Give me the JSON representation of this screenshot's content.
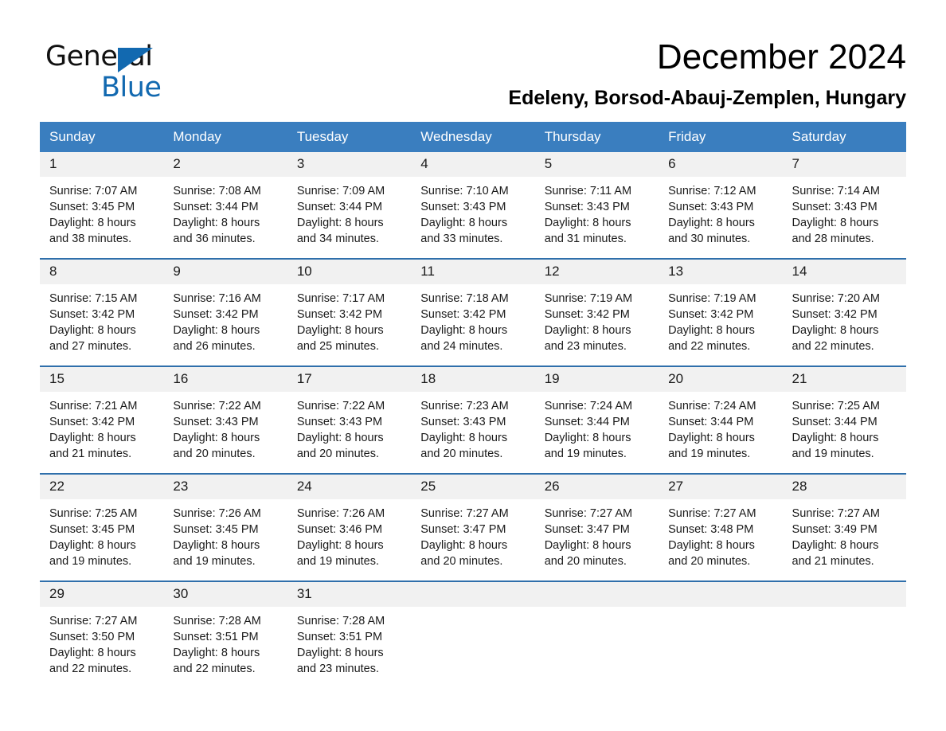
{
  "brand": {
    "name_part1": "General",
    "name_part2": "Blue",
    "logo_icon": "triangle-flag-icon",
    "accent_color": "#1269b0"
  },
  "header": {
    "month_title": "December 2024",
    "location": "Edeleny, Borsod-Abauj-Zemplen, Hungary"
  },
  "theme": {
    "header_blue": "#3a7ebf",
    "row_divider_blue": "#2f6fab",
    "day_band_gray": "#f1f1f1"
  },
  "calendar": {
    "weekdays": [
      "Sunday",
      "Monday",
      "Tuesday",
      "Wednesday",
      "Thursday",
      "Friday",
      "Saturday"
    ],
    "labels": {
      "sunrise": "Sunrise:",
      "sunset": "Sunset:",
      "daylight": "Daylight:"
    },
    "weeks": [
      [
        {
          "date": "1",
          "sunrise": "Sunrise: 7:07 AM",
          "sunset": "Sunset: 3:45 PM",
          "daylight_line1": "Daylight: 8 hours",
          "daylight_line2": "and 38 minutes."
        },
        {
          "date": "2",
          "sunrise": "Sunrise: 7:08 AM",
          "sunset": "Sunset: 3:44 PM",
          "daylight_line1": "Daylight: 8 hours",
          "daylight_line2": "and 36 minutes."
        },
        {
          "date": "3",
          "sunrise": "Sunrise: 7:09 AM",
          "sunset": "Sunset: 3:44 PM",
          "daylight_line1": "Daylight: 8 hours",
          "daylight_line2": "and 34 minutes."
        },
        {
          "date": "4",
          "sunrise": "Sunrise: 7:10 AM",
          "sunset": "Sunset: 3:43 PM",
          "daylight_line1": "Daylight: 8 hours",
          "daylight_line2": "and 33 minutes."
        },
        {
          "date": "5",
          "sunrise": "Sunrise: 7:11 AM",
          "sunset": "Sunset: 3:43 PM",
          "daylight_line1": "Daylight: 8 hours",
          "daylight_line2": "and 31 minutes."
        },
        {
          "date": "6",
          "sunrise": "Sunrise: 7:12 AM",
          "sunset": "Sunset: 3:43 PM",
          "daylight_line1": "Daylight: 8 hours",
          "daylight_line2": "and 30 minutes."
        },
        {
          "date": "7",
          "sunrise": "Sunrise: 7:14 AM",
          "sunset": "Sunset: 3:43 PM",
          "daylight_line1": "Daylight: 8 hours",
          "daylight_line2": "and 28 minutes."
        }
      ],
      [
        {
          "date": "8",
          "sunrise": "Sunrise: 7:15 AM",
          "sunset": "Sunset: 3:42 PM",
          "daylight_line1": "Daylight: 8 hours",
          "daylight_line2": "and 27 minutes."
        },
        {
          "date": "9",
          "sunrise": "Sunrise: 7:16 AM",
          "sunset": "Sunset: 3:42 PM",
          "daylight_line1": "Daylight: 8 hours",
          "daylight_line2": "and 26 minutes."
        },
        {
          "date": "10",
          "sunrise": "Sunrise: 7:17 AM",
          "sunset": "Sunset: 3:42 PM",
          "daylight_line1": "Daylight: 8 hours",
          "daylight_line2": "and 25 minutes."
        },
        {
          "date": "11",
          "sunrise": "Sunrise: 7:18 AM",
          "sunset": "Sunset: 3:42 PM",
          "daylight_line1": "Daylight: 8 hours",
          "daylight_line2": "and 24 minutes."
        },
        {
          "date": "12",
          "sunrise": "Sunrise: 7:19 AM",
          "sunset": "Sunset: 3:42 PM",
          "daylight_line1": "Daylight: 8 hours",
          "daylight_line2": "and 23 minutes."
        },
        {
          "date": "13",
          "sunrise": "Sunrise: 7:19 AM",
          "sunset": "Sunset: 3:42 PM",
          "daylight_line1": "Daylight: 8 hours",
          "daylight_line2": "and 22 minutes."
        },
        {
          "date": "14",
          "sunrise": "Sunrise: 7:20 AM",
          "sunset": "Sunset: 3:42 PM",
          "daylight_line1": "Daylight: 8 hours",
          "daylight_line2": "and 22 minutes."
        }
      ],
      [
        {
          "date": "15",
          "sunrise": "Sunrise: 7:21 AM",
          "sunset": "Sunset: 3:42 PM",
          "daylight_line1": "Daylight: 8 hours",
          "daylight_line2": "and 21 minutes."
        },
        {
          "date": "16",
          "sunrise": "Sunrise: 7:22 AM",
          "sunset": "Sunset: 3:43 PM",
          "daylight_line1": "Daylight: 8 hours",
          "daylight_line2": "and 20 minutes."
        },
        {
          "date": "17",
          "sunrise": "Sunrise: 7:22 AM",
          "sunset": "Sunset: 3:43 PM",
          "daylight_line1": "Daylight: 8 hours",
          "daylight_line2": "and 20 minutes."
        },
        {
          "date": "18",
          "sunrise": "Sunrise: 7:23 AM",
          "sunset": "Sunset: 3:43 PM",
          "daylight_line1": "Daylight: 8 hours",
          "daylight_line2": "and 20 minutes."
        },
        {
          "date": "19",
          "sunrise": "Sunrise: 7:24 AM",
          "sunset": "Sunset: 3:44 PM",
          "daylight_line1": "Daylight: 8 hours",
          "daylight_line2": "and 19 minutes."
        },
        {
          "date": "20",
          "sunrise": "Sunrise: 7:24 AM",
          "sunset": "Sunset: 3:44 PM",
          "daylight_line1": "Daylight: 8 hours",
          "daylight_line2": "and 19 minutes."
        },
        {
          "date": "21",
          "sunrise": "Sunrise: 7:25 AM",
          "sunset": "Sunset: 3:44 PM",
          "daylight_line1": "Daylight: 8 hours",
          "daylight_line2": "and 19 minutes."
        }
      ],
      [
        {
          "date": "22",
          "sunrise": "Sunrise: 7:25 AM",
          "sunset": "Sunset: 3:45 PM",
          "daylight_line1": "Daylight: 8 hours",
          "daylight_line2": "and 19 minutes."
        },
        {
          "date": "23",
          "sunrise": "Sunrise: 7:26 AM",
          "sunset": "Sunset: 3:45 PM",
          "daylight_line1": "Daylight: 8 hours",
          "daylight_line2": "and 19 minutes."
        },
        {
          "date": "24",
          "sunrise": "Sunrise: 7:26 AM",
          "sunset": "Sunset: 3:46 PM",
          "daylight_line1": "Daylight: 8 hours",
          "daylight_line2": "and 19 minutes."
        },
        {
          "date": "25",
          "sunrise": "Sunrise: 7:27 AM",
          "sunset": "Sunset: 3:47 PM",
          "daylight_line1": "Daylight: 8 hours",
          "daylight_line2": "and 20 minutes."
        },
        {
          "date": "26",
          "sunrise": "Sunrise: 7:27 AM",
          "sunset": "Sunset: 3:47 PM",
          "daylight_line1": "Daylight: 8 hours",
          "daylight_line2": "and 20 minutes."
        },
        {
          "date": "27",
          "sunrise": "Sunrise: 7:27 AM",
          "sunset": "Sunset: 3:48 PM",
          "daylight_line1": "Daylight: 8 hours",
          "daylight_line2": "and 20 minutes."
        },
        {
          "date": "28",
          "sunrise": "Sunrise: 7:27 AM",
          "sunset": "Sunset: 3:49 PM",
          "daylight_line1": "Daylight: 8 hours",
          "daylight_line2": "and 21 minutes."
        }
      ],
      [
        {
          "date": "29",
          "sunrise": "Sunrise: 7:27 AM",
          "sunset": "Sunset: 3:50 PM",
          "daylight_line1": "Daylight: 8 hours",
          "daylight_line2": "and 22 minutes."
        },
        {
          "date": "30",
          "sunrise": "Sunrise: 7:28 AM",
          "sunset": "Sunset: 3:51 PM",
          "daylight_line1": "Daylight: 8 hours",
          "daylight_line2": "and 22 minutes."
        },
        {
          "date": "31",
          "sunrise": "Sunrise: 7:28 AM",
          "sunset": "Sunset: 3:51 PM",
          "daylight_line1": "Daylight: 8 hours",
          "daylight_line2": "and 23 minutes."
        },
        {
          "date": "",
          "sunrise": "",
          "sunset": "",
          "daylight_line1": "",
          "daylight_line2": ""
        },
        {
          "date": "",
          "sunrise": "",
          "sunset": "",
          "daylight_line1": "",
          "daylight_line2": ""
        },
        {
          "date": "",
          "sunrise": "",
          "sunset": "",
          "daylight_line1": "",
          "daylight_line2": ""
        },
        {
          "date": "",
          "sunrise": "",
          "sunset": "",
          "daylight_line1": "",
          "daylight_line2": ""
        }
      ]
    ]
  }
}
